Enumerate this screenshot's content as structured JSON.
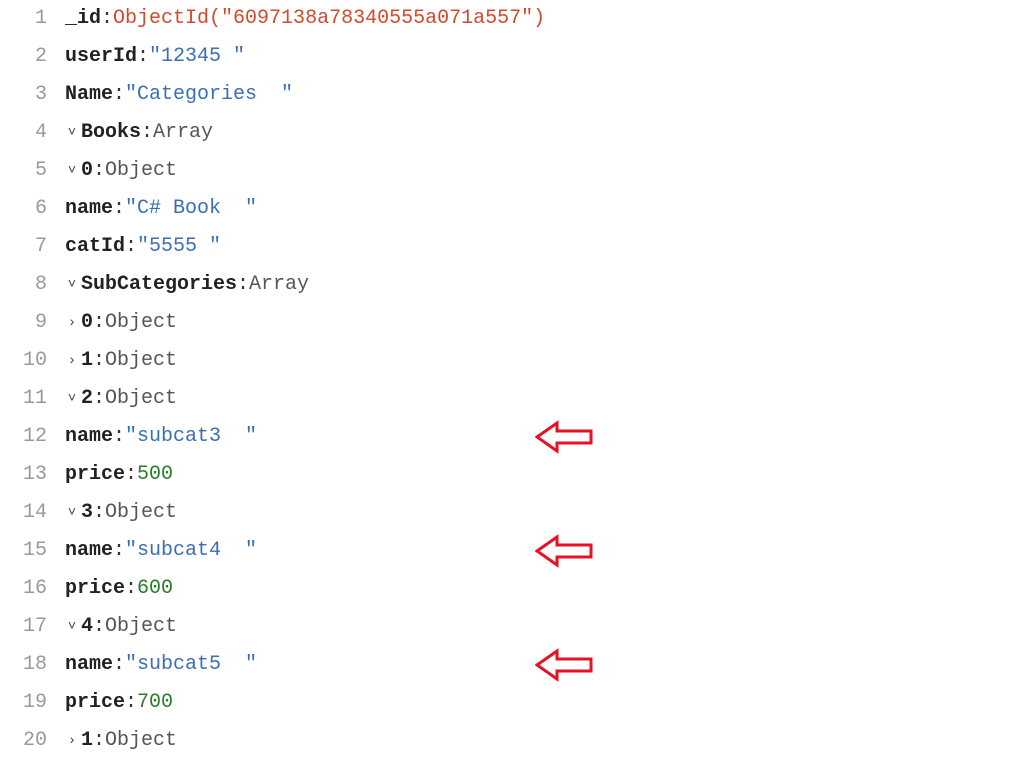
{
  "lines": {
    "n1": "1",
    "n2": "2",
    "n3": "3",
    "n4": "4",
    "n5": "5",
    "n6": "6",
    "n7": "7",
    "n8": "8",
    "n9": "9",
    "n10": "10",
    "n11": "11",
    "n12": "12",
    "n13": "13",
    "n14": "14",
    "n15": "15",
    "n16": "16",
    "n17": "17",
    "n18": "18",
    "n19": "19",
    "n20": "20"
  },
  "doc": {
    "id_key": "_id",
    "id_val": "ObjectId(\"6097138a78340555a071a557\")",
    "userId_key": "userId",
    "userId_val": "\"12345 \"",
    "name_key": "Name",
    "name_val": "\"Categories  \"",
    "books_key": "Books",
    "array_type": "Array",
    "object_type": "Object",
    "idx0": "0",
    "idx1": "1",
    "idx2": "2",
    "idx3": "3",
    "idx4": "4",
    "book0_name_key": "name",
    "book0_name_val": "\"C# Book  \"",
    "book0_catId_key": "catId",
    "book0_catId_val": "\"5555 \"",
    "subcat_key": "SubCategories",
    "sc2_name_key": "name",
    "sc2_name_val": "\"subcat3  \"",
    "sc2_price_key": "price",
    "sc2_price_val": "500",
    "sc3_name_key": "name",
    "sc3_name_val": "\"subcat4  \"",
    "sc3_price_key": "price",
    "sc3_price_val": "600",
    "sc4_name_key": "name",
    "sc4_name_val": "\"subcat5  \"",
    "sc4_price_key": "price",
    "sc4_price_val": "700",
    "last_idx": "1",
    "last_type": "Object"
  },
  "sep": {
    "colon": ":",
    "colon_sp": " : "
  }
}
